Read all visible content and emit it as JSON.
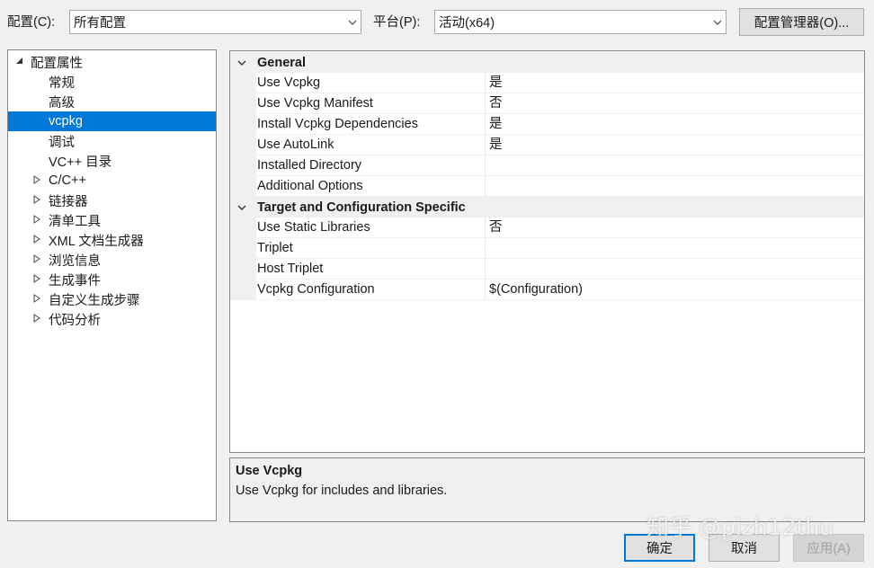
{
  "toolbar": {
    "config_label": "配置(C):",
    "config_value": "所有配置",
    "platform_label": "平台(P):",
    "platform_value": "活动(x64)",
    "config_manager_label": "配置管理器(O)..."
  },
  "tree": {
    "root": "配置属性",
    "items": [
      {
        "label": "常规",
        "expandable": false
      },
      {
        "label": "高级",
        "expandable": false
      },
      {
        "label": "vcpkg",
        "expandable": false,
        "selected": true
      },
      {
        "label": "调试",
        "expandable": false
      },
      {
        "label": "VC++ 目录",
        "expandable": false
      },
      {
        "label": "C/C++",
        "expandable": true
      },
      {
        "label": "链接器",
        "expandable": true
      },
      {
        "label": "清单工具",
        "expandable": true
      },
      {
        "label": "XML 文档生成器",
        "expandable": true
      },
      {
        "label": "浏览信息",
        "expandable": true
      },
      {
        "label": "生成事件",
        "expandable": true
      },
      {
        "label": "自定义生成步骤",
        "expandable": true
      },
      {
        "label": "代码分析",
        "expandable": true
      }
    ]
  },
  "grid": {
    "categories": [
      {
        "name": "General",
        "rows": [
          {
            "name": "Use Vcpkg",
            "value": "是"
          },
          {
            "name": "Use Vcpkg Manifest",
            "value": "否"
          },
          {
            "name": "Install Vcpkg Dependencies",
            "value": "是"
          },
          {
            "name": "Use AutoLink",
            "value": "是"
          },
          {
            "name": "Installed Directory",
            "value": ""
          },
          {
            "name": "Additional Options",
            "value": ""
          }
        ]
      },
      {
        "name": "Target and Configuration Specific",
        "rows": [
          {
            "name": "Use Static Libraries",
            "value": "否"
          },
          {
            "name": "Triplet",
            "value": ""
          },
          {
            "name": "Host Triplet",
            "value": ""
          },
          {
            "name": "Vcpkg Configuration",
            "value": "$(Configuration)"
          }
        ]
      }
    ]
  },
  "description": {
    "title": "Use Vcpkg",
    "text": "Use Vcpkg for includes and libraries."
  },
  "buttons": {
    "ok": "确定",
    "cancel": "取消",
    "apply": "应用(A)"
  },
  "watermark": "知乎 @pizh12thu",
  "icons": {
    "dropdown": "chevron-down-icon",
    "tree_root": "expanded-triangle-icon",
    "tree_collapsed": "collapsed-triangle-icon",
    "category_toggle": "chevron-down-icon"
  },
  "colors": {
    "selection": "#0078d7",
    "background": "#f0f0f0",
    "border": "#828790"
  }
}
